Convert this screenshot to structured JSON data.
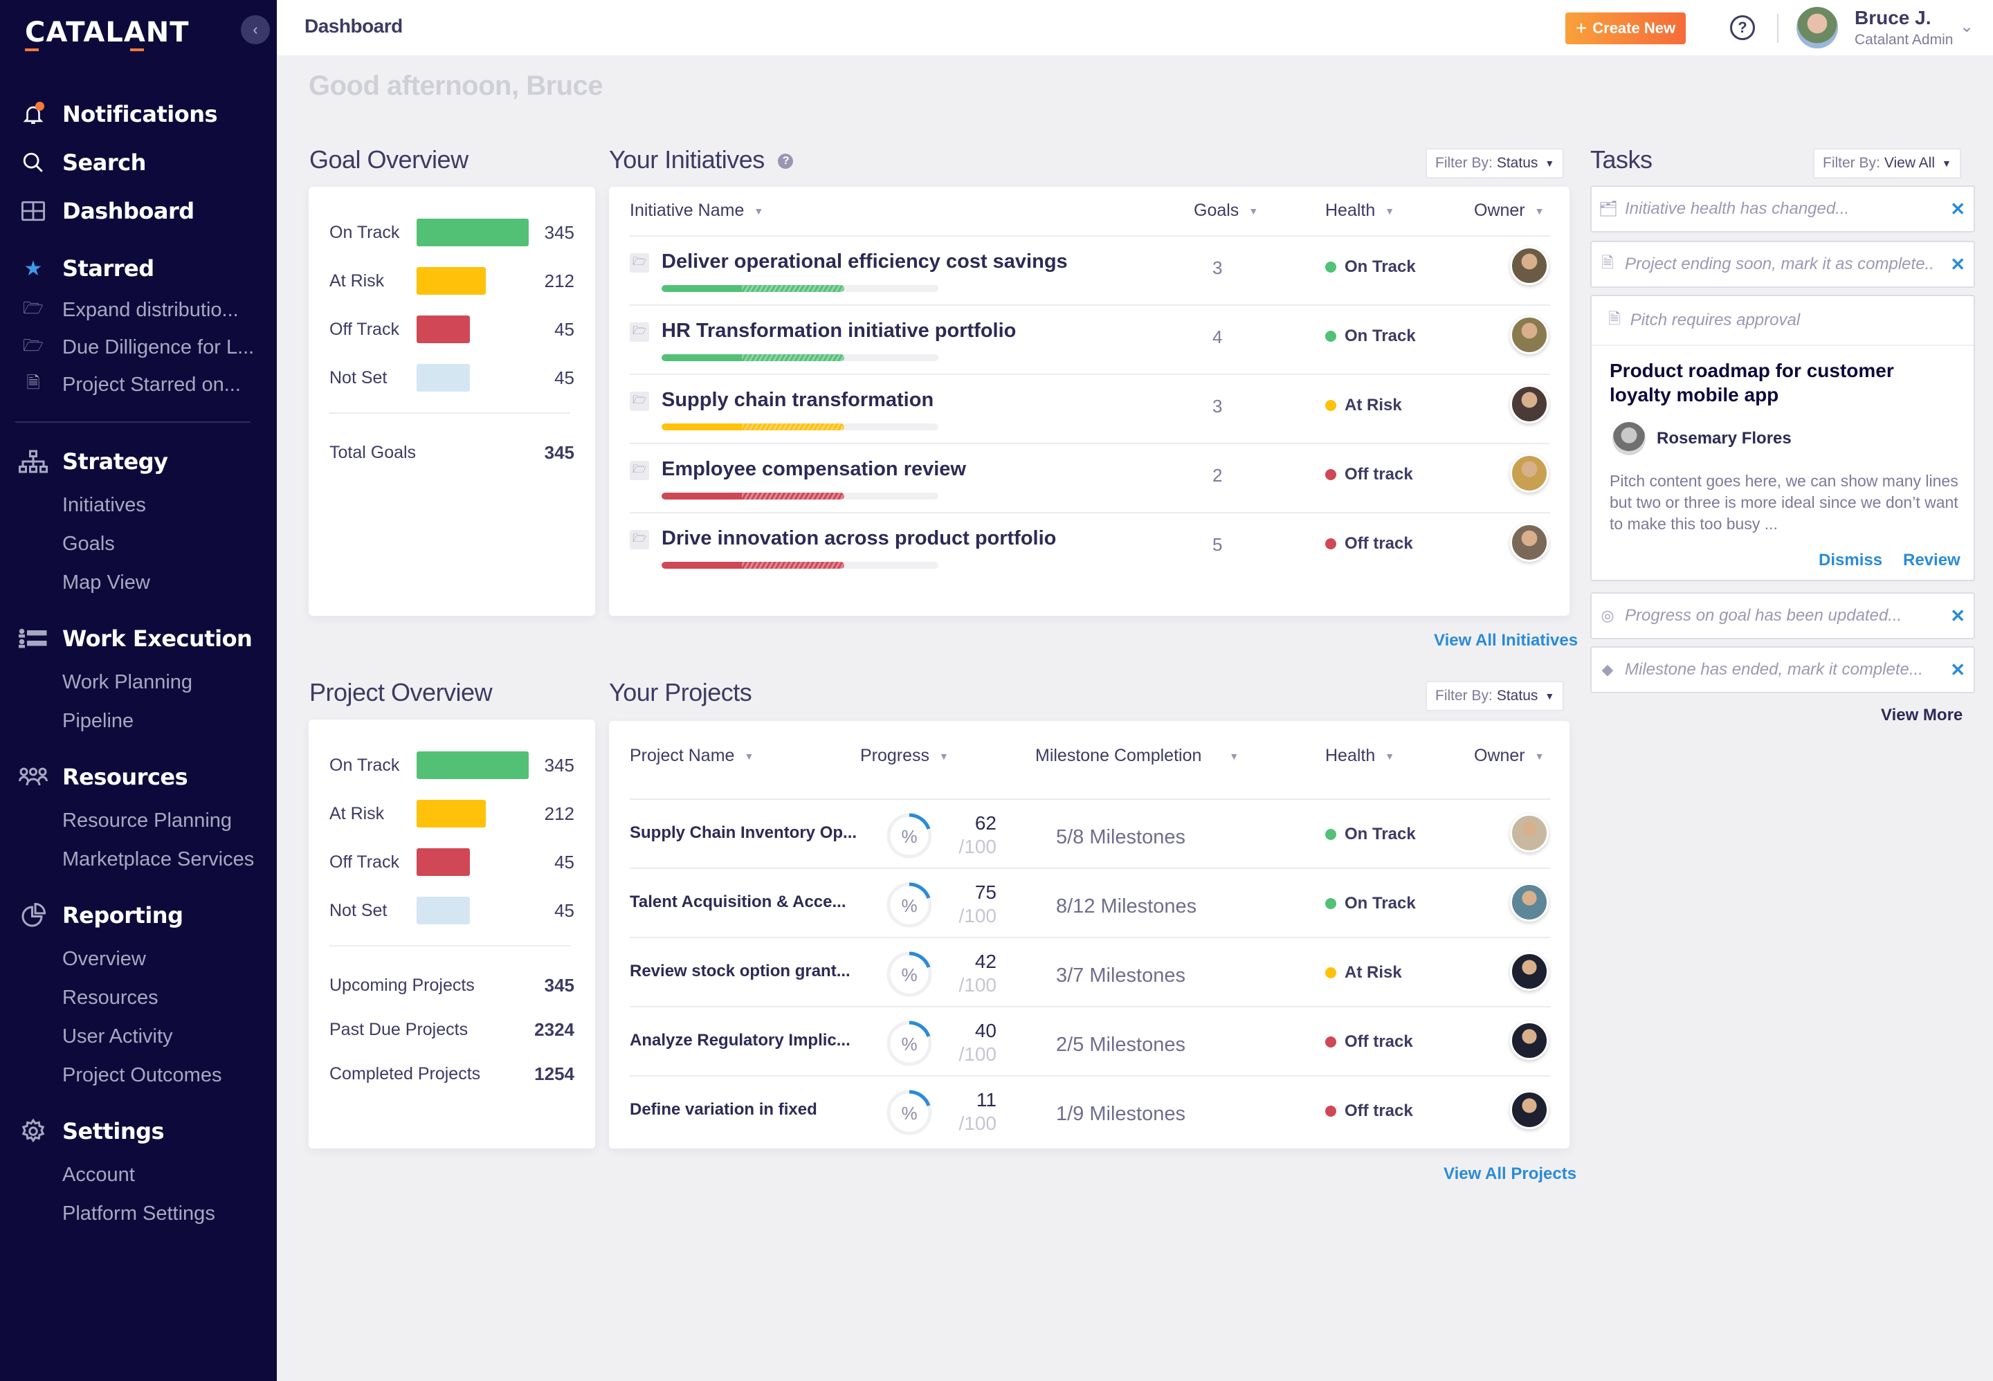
{
  "app": {
    "logo": "CATALANT",
    "collapse_icon": "chevron-left-icon"
  },
  "sidebar": {
    "top_items": [
      {
        "label": "Notifications",
        "icon": "bell-icon",
        "has_badge": true
      },
      {
        "label": "Search",
        "icon": "search-icon"
      },
      {
        "label": "Dashboard",
        "icon": "grid-icon"
      }
    ],
    "starred": {
      "label": "Starred",
      "icon": "star-icon",
      "items": [
        {
          "label": "Expand distributio...",
          "icon": "folder-icon"
        },
        {
          "label": "Due Dilligence for L...",
          "icon": "folder-icon"
        },
        {
          "label": "Project Starred on...",
          "icon": "document-icon"
        }
      ]
    },
    "sections": [
      {
        "label": "Strategy",
        "icon": "hierarchy-icon",
        "items": [
          "Initiatives",
          "Goals",
          "Map View"
        ]
      },
      {
        "label": "Work Execution",
        "icon": "work-list-icon",
        "items": [
          "Work Planning",
          "Pipeline"
        ]
      },
      {
        "label": "Resources",
        "icon": "people-icon",
        "items": [
          "Resource Planning",
          "Marketplace Services"
        ]
      },
      {
        "label": "Reporting",
        "icon": "pie-chart-icon",
        "items": [
          "Overview",
          "Resources",
          "User Activity",
          "Project Outcomes"
        ]
      },
      {
        "label": "Settings",
        "icon": "gear-icon",
        "items": [
          "Account",
          "Platform Settings"
        ]
      }
    ]
  },
  "header": {
    "title": "Dashboard",
    "create_button": "Create New",
    "help_icon": "question-icon",
    "user": {
      "name": "Bruce J.",
      "role": "Catalant Admin"
    }
  },
  "greeting": "Good afternoon, Bruce",
  "goal_overview": {
    "title": "Goal Overview",
    "rows": [
      {
        "label": "On Track",
        "value": 345,
        "color": "#52c175"
      },
      {
        "label": "At Risk",
        "value": 212,
        "color": "#ffc10a"
      },
      {
        "label": "Off Track",
        "value": 45,
        "color": "#d04755"
      },
      {
        "label": "Not Set",
        "value": 45,
        "color": "#d5e6f3"
      }
    ],
    "stats": [
      {
        "label": "Total Goals",
        "value": "345"
      }
    ]
  },
  "project_overview": {
    "title": "Project Overview",
    "rows": [
      {
        "label": "On Track",
        "value": 345,
        "color": "#52c175"
      },
      {
        "label": "At Risk",
        "value": 212,
        "color": "#ffc10a"
      },
      {
        "label": "Off Track",
        "value": 45,
        "color": "#d04755"
      },
      {
        "label": "Not Set",
        "value": 45,
        "color": "#d5e6f3"
      }
    ],
    "stats": [
      {
        "label": "Upcoming Projects",
        "value": "345"
      },
      {
        "label": "Past Due Projects",
        "value": "2324"
      },
      {
        "label": "Completed Projects",
        "value": "1254"
      }
    ]
  },
  "initiatives": {
    "title": "Your Initiatives",
    "filter_label": "Filter By:",
    "filter_value": "Status",
    "columns": [
      "Initiative Name",
      "Goals",
      "Health",
      "Owner"
    ],
    "rows": [
      {
        "name": "Deliver operational efficiency cost savings",
        "goals": "3",
        "health": "On Track",
        "health_color": "#52c175",
        "progress_solid": 0.29,
        "progress_projected": 0.66,
        "owner_tone": "#6b5b45"
      },
      {
        "name": "HR Transformation initiative portfolio",
        "goals": "4",
        "health": "On Track",
        "health_color": "#52c175",
        "progress_solid": 0.29,
        "progress_projected": 0.66,
        "owner_tone": "#8a7a50"
      },
      {
        "name": "Supply chain transformation",
        "goals": "3",
        "health": "At Risk",
        "health_color": "#ffc10a",
        "progress_solid": 0.29,
        "progress_projected": 0.66,
        "owner_tone": "#4a3a38"
      },
      {
        "name": "Employee compensation review",
        "goals": "2",
        "health": "Off track",
        "health_color": "#d04755",
        "progress_solid": 0.29,
        "progress_projected": 0.66,
        "owner_tone": "#c9a050"
      },
      {
        "name": "Drive innovation across product portfolio",
        "goals": "5",
        "health": "Off track",
        "health_color": "#d04755",
        "progress_solid": 0.29,
        "progress_projected": 0.66,
        "owner_tone": "#7a6858"
      }
    ],
    "view_all": "View All Initiatives"
  },
  "projects": {
    "title": "Your Projects",
    "filter_label": "Filter By:",
    "filter_value": "Status",
    "columns": [
      "Project Name",
      "Progress",
      "Milestone Completion",
      "Health",
      "Owner"
    ],
    "rows": [
      {
        "name": "Supply Chain Inventory Op...",
        "progress": "62",
        "max": "/100",
        "milestones": "5/8 Milestones",
        "health": "On Track",
        "health_color": "#52c175",
        "owner_tone": "#c8b8a0"
      },
      {
        "name": "Talent Acquisition & Acce...",
        "progress": "75",
        "max": "/100",
        "milestones": "8/12 Milestones",
        "health": "On Track",
        "health_color": "#52c175",
        "owner_tone": "#5d8799"
      },
      {
        "name": "Review stock option grant...",
        "progress": "42",
        "max": "/100",
        "milestones": "3/7 Milestones",
        "health": "At Risk",
        "health_color": "#ffc10a",
        "owner_tone": "#1c2030"
      },
      {
        "name": "Analyze Regulatory Implic...",
        "progress": "40",
        "max": "/100",
        "milestones": "2/5 Milestones",
        "health": "Off track",
        "health_color": "#d04755",
        "owner_tone": "#1c2030"
      },
      {
        "name": "Define variation in fixed",
        "progress": "11",
        "max": "/100",
        "milestones": "1/9 Milestones",
        "health": "Off track",
        "health_color": "#d04755",
        "owner_tone": "#1c2030"
      }
    ],
    "ring_symbol": "%",
    "view_all": "View All Projects"
  },
  "tasks": {
    "title": "Tasks",
    "filter_label": "Filter By:",
    "filter_value": "View All",
    "items": [
      {
        "text": "Initiative health has changed...",
        "icon": "folder-open-icon"
      },
      {
        "text": "Project ending soon, mark it as complete..",
        "icon": "document-icon"
      }
    ],
    "pitch": {
      "header": "Pitch requires approval",
      "title": "Product roadmap for customer loyalty mobile app",
      "author": "Rosemary Flores",
      "body": "Pitch content goes here, we can show many lines but two or three is more ideal since we don’t want to make this too busy ...",
      "dismiss": "Dismiss",
      "review": "Review"
    },
    "items_after": [
      {
        "text": "Progress on goal has been updated...",
        "icon": "target-icon"
      },
      {
        "text": "Milestone has ended, mark it complete...",
        "icon": "diamond-icon"
      }
    ],
    "view_more": "View More"
  }
}
